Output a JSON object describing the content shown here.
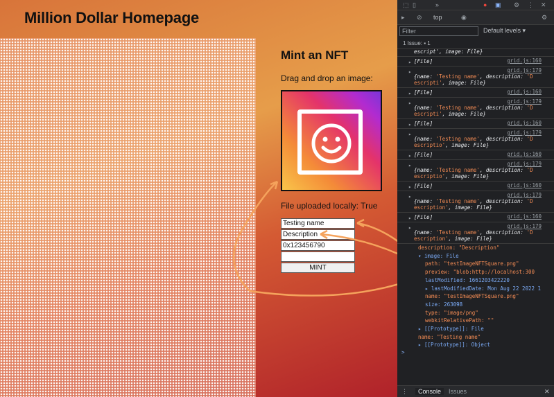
{
  "page": {
    "title": "Million Dollar Homepage",
    "mint_title": "Mint an NFT",
    "drag_label": "Drag and drop an image:",
    "upload_status": "File uploaded locally: True",
    "name_value": "Testing name",
    "description_value": "Description",
    "address_value": "0x123456790",
    "empty_value": "",
    "mint_label": "MINT"
  },
  "devtools": {
    "context": "top",
    "filter_placeholder": "Filter",
    "levels": "Default levels ▾",
    "issue": "1 Issue: ▪ 1",
    "partial_top": "escript', image: File}",
    "logs": [
      {
        "src": "grid.js:160",
        "type": "file",
        "text": "[File]"
      },
      {
        "src": "grid.js:179",
        "type": "obj",
        "name": "'Testing name'",
        "desc": "'D escripti'"
      },
      {
        "src": "grid.js:160",
        "type": "file",
        "text": "[File]"
      },
      {
        "src": "grid.js:179",
        "type": "obj",
        "name": "'Testing name'",
        "desc": "'D escripti'"
      },
      {
        "src": "grid.js:160",
        "type": "file",
        "text": "[File]"
      },
      {
        "src": "grid.js:179",
        "type": "obj",
        "name": "'Testing name'",
        "desc": "'D escriptio'"
      },
      {
        "src": "grid.js:160",
        "type": "file",
        "text": "[File]"
      },
      {
        "src": "grid.js:179",
        "type": "obj",
        "name": "'Testing name'",
        "desc": "'D escriptio'"
      },
      {
        "src": "grid.js:160",
        "type": "file",
        "text": "[File]"
      },
      {
        "src": "grid.js:179",
        "type": "obj",
        "name": "'Testing name'",
        "desc": "'D escription'"
      },
      {
        "src": "grid.js:160",
        "type": "file",
        "text": "[File]"
      },
      {
        "src": "grid.js:179",
        "type": "obj",
        "name": "'Testing name'",
        "desc": "'D escription'"
      }
    ],
    "tree": [
      "description: \"Description\"",
      "▾ image: File",
      "path: \"testImageNFTSquare.png\"",
      "preview: \"blob:http://localhost:300",
      "lastModified: 1661203422220",
      "▸ lastModifiedDate: Mon Aug 22 2022 1",
      "name: \"testImageNFTSquare.png\"",
      "size: 263098",
      "type: \"image/png\"",
      "webkitRelativePath: \"\"",
      "▸ [[Prototype]]: File",
      "name: \"Testing name\"",
      "▸ [[Prototype]]: Object"
    ],
    "prompt": ">",
    "tab_console": "Console",
    "tab_issues": "Issues"
  },
  "colors": {
    "arrow": "#f5a35c",
    "accent": "#1a73e8"
  }
}
